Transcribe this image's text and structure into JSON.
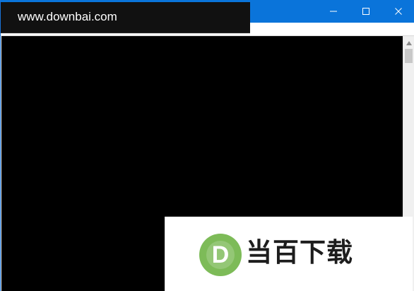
{
  "window": {
    "title": "",
    "controls": {
      "minimize_icon": "minimize-icon",
      "maximize_icon": "maximize-icon",
      "close_icon": "close-icon"
    }
  },
  "console": {
    "background_color": "#000000"
  },
  "scrollbar": {
    "up_icon": "scroll-up-arrow-icon"
  },
  "watermarks": {
    "site": "www.downbai.com",
    "brand_logo_letter": "D",
    "brand_name": "当百下载",
    "brand_color": "#7dbb58"
  },
  "colors": {
    "titlebar": "#0a74da",
    "watermark_bg": "#111111"
  }
}
